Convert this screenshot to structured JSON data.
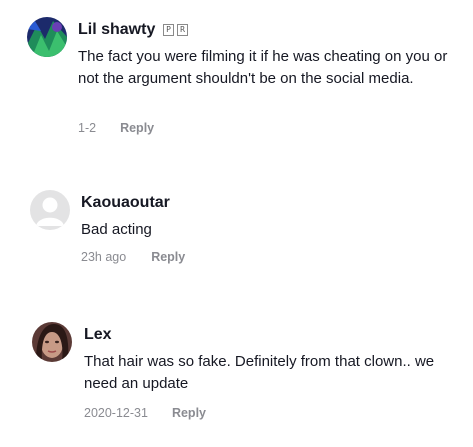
{
  "comments": [
    {
      "username": "Lil shawty",
      "badges": [
        "P",
        "R"
      ],
      "text": "The fact you were filming it if he was cheating on you or not the argument shouldn't be on the social media.",
      "date": "1-2",
      "reply_label": "Reply"
    },
    {
      "username": "Kaouaoutar",
      "text": "Bad acting",
      "date": "23h ago",
      "reply_label": "Reply"
    },
    {
      "username": "Lex",
      "text": "That hair was so fake. Definitely from that clown.. we need an update",
      "date": "2020-12-31",
      "reply_label": "Reply"
    }
  ]
}
